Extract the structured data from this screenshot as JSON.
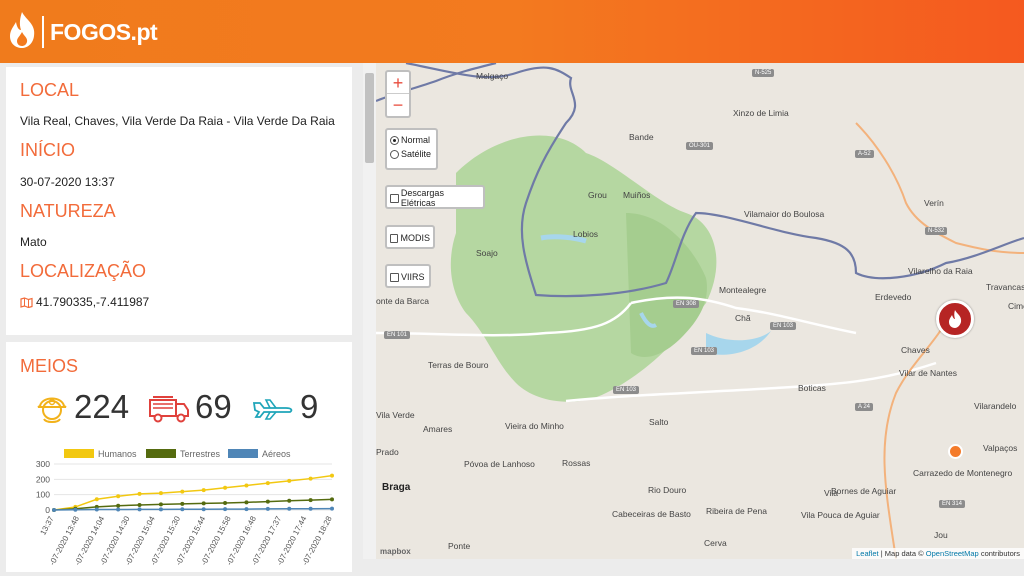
{
  "header": {
    "brand": "FOGOS.pt"
  },
  "details": {
    "local_title": "LOCAL",
    "local_value": "Vila Real, Chaves, Vila Verde Da Raia - Vila Verde Da Raia",
    "inicio_title": "INÍCIO",
    "inicio_value": "30-07-2020 13:37",
    "natureza_title": "NATUREZA",
    "natureza_value": "Mato",
    "localizacao_title": "LOCALIZAÇÃO",
    "localizacao_value": "41.790335,-7.411987"
  },
  "meios": {
    "title": "MEIOS",
    "humanos": "224",
    "terrestres": "69",
    "aereos": "9"
  },
  "chart_data": {
    "type": "line",
    "series": [
      {
        "name": "Humanos",
        "color": "#f2c811",
        "values": [
          0,
          20,
          70,
          90,
          105,
          110,
          120,
          130,
          145,
          160,
          175,
          190,
          205,
          224
        ]
      },
      {
        "name": "Terrestres",
        "color": "#556b0f",
        "values": [
          0,
          8,
          20,
          28,
          33,
          37,
          40,
          43,
          46,
          50,
          55,
          60,
          64,
          69
        ]
      },
      {
        "name": "Aéreos",
        "color": "#4f86b7",
        "values": [
          0,
          2,
          3,
          3,
          4,
          4,
          5,
          5,
          6,
          6,
          7,
          8,
          8,
          9
        ]
      }
    ],
    "y_ticks": [
      "300",
      "200",
      "100",
      "0"
    ],
    "x_ticks": [
      "13:37",
      "-07-2020 13:48",
      "-07-2020 14:04",
      "-07-2020 14:30",
      "-07-2020 15:04",
      "-07-2020 15:30",
      "-07-2020 15:44",
      "-07-2020 15:58",
      "-07-2020 16:48",
      "-07-2020 17:37",
      "-07-2020 17:44",
      "-07-2020 18:28"
    ],
    "ylim": [
      0,
      300
    ]
  },
  "map": {
    "zoom_in": "+",
    "zoom_out": "−",
    "layer_normal": "Normal",
    "layer_satellite": "Satélite",
    "overlay_descargas": "Descargas Elétricas",
    "overlay_modis": "MODIS",
    "overlay_viirs": "VIIRS",
    "labels": [
      "Melgaço",
      "Xinzo de Limia",
      "Bande",
      "Grou",
      "Muiños",
      "Lobios",
      "Vilamaior do Boulosa",
      "Verín",
      "Soajo",
      "Montealegre",
      "Vilarelho da Raia",
      "Travancas",
      "Erdevedo",
      "Chã",
      "onte da Barca",
      "Chaves",
      "Vilar de Nantes",
      "Terras de Bouro",
      "Boticas",
      "Vilarandelo",
      "Cime",
      "Amares",
      "Vieira do Minho",
      "Salto",
      "Valpaços",
      "Prado",
      "Braga",
      "Póvoa de Lanhoso",
      "Rossas",
      "Carrazedo de Montenegro",
      "Bornes de Aguiar",
      "Cabeceiras de Basto",
      "Ribeira de Pena",
      "Vila Pouca de Aguiar",
      "Jou",
      "Ponte",
      "Cerva",
      "Vila Verde",
      "Rio Douro",
      "Vila"
    ],
    "roads": [
      "N-525",
      "OU-301",
      "A-52",
      "N-532",
      "EN 308",
      "EN 103",
      "EN 103",
      "EN 101",
      "EN 103",
      "A 24",
      "EN 314"
    ],
    "attribution_leaflet": "Leaflet",
    "attribution_text": "| Map data ©",
    "attribution_osm": "OpenStreetMap",
    "attribution_tail": "contributors",
    "mapbox_logo": "mapbox"
  }
}
